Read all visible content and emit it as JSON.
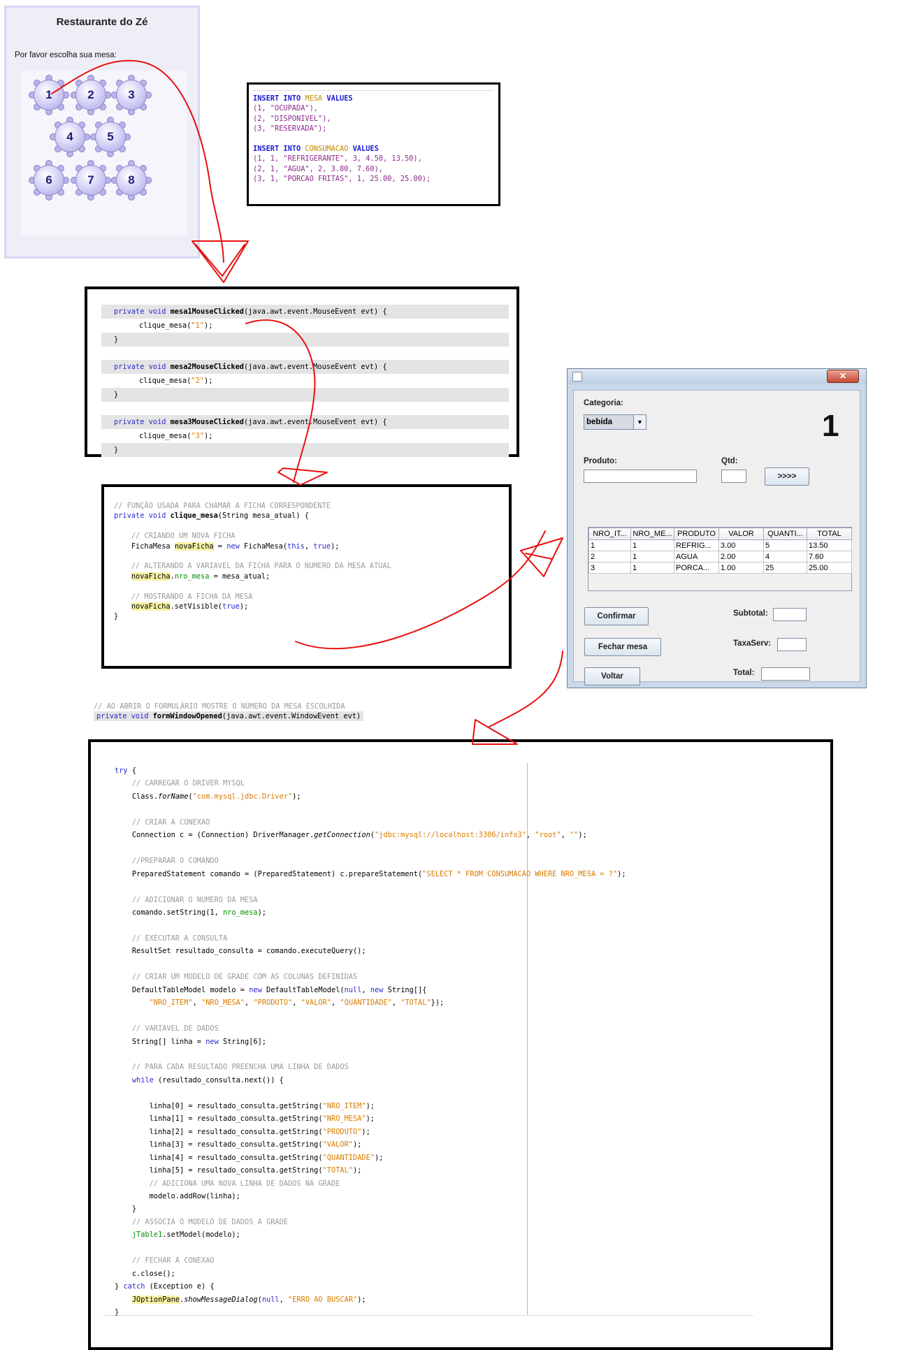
{
  "restaurant": {
    "title": "Restaurante do Zé",
    "prompt": "Por favor escolha sua mesa:",
    "tables": [
      "1",
      "2",
      "3",
      "4",
      "5",
      "6",
      "7",
      "8"
    ]
  },
  "sql": {
    "lines": [
      [
        [
          "kw",
          "INSERT INTO "
        ],
        [
          "tbl",
          "MESA"
        ],
        [
          "kw",
          " VALUES"
        ]
      ],
      [
        [
          "num",
          "(1, \"OCUPADA\"),"
        ]
      ],
      [
        [
          "num",
          "(2, \"DISPONIVEL\"),"
        ]
      ],
      [
        [
          "num",
          "(3, \"RESERVADA\");"
        ]
      ],
      [],
      [
        [
          "kw",
          "INSERT INTO "
        ],
        [
          "tbl",
          "CONSUMACAO"
        ],
        [
          "kw",
          " VALUES"
        ]
      ],
      [
        [
          "num",
          "(1, 1, \"REFRIGERANTE\", 3, 4.50, 13.50),"
        ]
      ],
      [
        [
          "num",
          "(2, 1, \"AGUA\", 2, 3.80, 7.60),"
        ]
      ],
      [
        [
          "num",
          "(3, 1, \"PORCAO FRITAS\", 1, 25.00, 25.00);"
        ]
      ]
    ]
  },
  "handlers": {
    "blocks": [
      {
        "sig_kw": "private void ",
        "sig_name": "mesa1MouseClicked",
        "sig_rest": "(java.awt.event.MouseEvent evt) {",
        "call": "clique_mesa(",
        "arg": "\"1\"",
        "end": ");",
        "close": "}"
      },
      {
        "sig_kw": "private void ",
        "sig_name": "mesa2MouseClicked",
        "sig_rest": "(java.awt.event.MouseEvent evt) {",
        "call": "clique_mesa(",
        "arg": "\"2\"",
        "end": ");",
        "close": "}"
      },
      {
        "sig_kw": "private void ",
        "sig_name": "mesa3MouseClicked",
        "sig_rest": "(java.awt.event.MouseEvent evt) {",
        "call": "clique_mesa(",
        "arg": "\"3\"",
        "end": ");",
        "close": "}"
      }
    ]
  },
  "clique": {
    "comment": "// FUNÇÃO USADA PARA CHAMAR A FICHA CORRESPONDENTE",
    "sig_kw": "private void ",
    "sig_name": "clique_mesa",
    "sig_rest": "(String mesa_atual) {",
    "c1": "// CRIANDO UM NOVA FICHA",
    "l1a": "FichaMesa ",
    "l1b": "novaFicha",
    "l1c": " = ",
    "l1d": "new",
    "l1e": " FichaMesa(",
    "l1f": "this",
    "l1g": ", ",
    "l1h": "true",
    "l1i": ");",
    "c2": "// ALTERANDO A VARIAVEL DA FICHA PARA O NUMERO DA MESA ATUAL",
    "l2a": "novaFicha",
    "l2b": ".",
    "l2c": "nro_mesa",
    "l2d": " = mesa_atual;",
    "c3": "// MOSTRANDO A FICHA DA MESA",
    "l3a": "novaFicha",
    "l3b": ".setVisible(",
    "l3c": "true",
    "l3d": ");",
    "close": "}"
  },
  "form": {
    "categoria_label": "Categoria:",
    "categoria_value": "bebida",
    "mesa_number": "1",
    "produto_label": "Produto:",
    "qtd_label": "Qtd:",
    "add_button": ">>>>",
    "columns": [
      "NRO_IT...",
      "NRO_ME...",
      "PRODUTO",
      "VALOR",
      "QUANTI...",
      "TOTAL"
    ],
    "rows": [
      [
        "1",
        "1",
        "REFRIG...",
        "3.00",
        "5",
        "13.50"
      ],
      [
        "2",
        "1",
        "AGUA",
        "2.00",
        "4",
        "7.60"
      ],
      [
        "3",
        "1",
        "PORCA...",
        "1.00",
        "25",
        "25.00"
      ]
    ],
    "confirmar": "Confirmar",
    "fechar": "Fechar mesa",
    "voltar": "Voltar",
    "subtotal_label": "Subtotal:",
    "taxa_label": "TaxaServ:",
    "total_label": "Total:"
  },
  "opened": {
    "comment": "// AO ABRIR O FORMULÁRIO MOSTRE O NÚMERO DA MESA ESCOLHIDA",
    "sig_kw": "private void ",
    "sig_name": "formWindowOpened",
    "sig_rest": "(java.awt.event.WindowEvent evt)"
  },
  "body_code": [
    [
      [
        "kw",
        "try"
      ],
      [
        "t",
        " {"
      ]
    ],
    [
      [
        "i",
        "    "
      ],
      [
        "cm",
        "// CARREGAR O DRIVER MYSQL"
      ]
    ],
    [
      [
        "i",
        "    "
      ],
      [
        "t",
        "Class."
      ],
      [
        "it",
        "forName"
      ],
      [
        "t",
        "("
      ],
      [
        "s",
        "\"com.mysql.jdbc.Driver\""
      ],
      [
        "t",
        ");"
      ]
    ],
    [],
    [
      [
        "i",
        "    "
      ],
      [
        "cm",
        "// CRIAR A CONEXAO"
      ]
    ],
    [
      [
        "i",
        "    "
      ],
      [
        "t",
        "Connection c = (Connection) DriverManager."
      ],
      [
        "it",
        "getConnection"
      ],
      [
        "t",
        "("
      ],
      [
        "s",
        "\"jdbc:mysql://localhost:3306/info3\""
      ],
      [
        "t",
        ", "
      ],
      [
        "s",
        "\"root\""
      ],
      [
        "t",
        ", "
      ],
      [
        "s",
        "\"\""
      ],
      [
        "t",
        ");"
      ]
    ],
    [],
    [
      [
        "i",
        "    "
      ],
      [
        "cm",
        "//PREPARAR O COMANDO"
      ]
    ],
    [
      [
        "i",
        "    "
      ],
      [
        "t",
        "PreparedStatement comando = (PreparedStatement) c.prepareStatement("
      ],
      [
        "s",
        "\"SELECT * FROM CONSUMACAO WHERE NRO_MESA = ?\""
      ],
      [
        "t",
        ");"
      ]
    ],
    [],
    [
      [
        "i",
        "    "
      ],
      [
        "cm",
        "// ADICIONAR O NUMERO DA MESA"
      ]
    ],
    [
      [
        "i",
        "    "
      ],
      [
        "t",
        "comando.setString(1, "
      ],
      [
        "f",
        "nro_mesa"
      ],
      [
        "t",
        ");"
      ]
    ],
    [],
    [
      [
        "i",
        "    "
      ],
      [
        "cm",
        "// EXECUTAR A CONSULTA"
      ]
    ],
    [
      [
        "i",
        "    "
      ],
      [
        "t",
        "ResultSet resultado_consulta = comando.executeQuery();"
      ]
    ],
    [],
    [
      [
        "i",
        "    "
      ],
      [
        "cm",
        "// CRIAR UM MODELO DE GRADE COM AS COLUNAS DEFINIDAS"
      ]
    ],
    [
      [
        "i",
        "    "
      ],
      [
        "t",
        "DefaultTableModel modelo = "
      ],
      [
        "kw",
        "new"
      ],
      [
        "t",
        " DefaultTableModel("
      ],
      [
        "kw",
        "null"
      ],
      [
        "t",
        ", "
      ],
      [
        "kw",
        "new"
      ],
      [
        "t",
        " String[]{"
      ]
    ],
    [
      [
        "i",
        "        "
      ],
      [
        "s",
        "\"NRO_ITEM\""
      ],
      [
        "t",
        ", "
      ],
      [
        "s",
        "\"NRO_MESA\""
      ],
      [
        "t",
        ", "
      ],
      [
        "s",
        "\"PRODUTO\""
      ],
      [
        "t",
        ", "
      ],
      [
        "s",
        "\"VALOR\""
      ],
      [
        "t",
        ", "
      ],
      [
        "s",
        "\"QUANTIDADE\""
      ],
      [
        "t",
        ", "
      ],
      [
        "s",
        "\"TOTAL\""
      ],
      [
        "t",
        "});"
      ]
    ],
    [],
    [
      [
        "i",
        "    "
      ],
      [
        "cm",
        "// VARIAVEL DE DADOS"
      ]
    ],
    [
      [
        "i",
        "    "
      ],
      [
        "t",
        "String[] linha = "
      ],
      [
        "kw",
        "new"
      ],
      [
        "t",
        " String[6];"
      ]
    ],
    [],
    [
      [
        "i",
        "    "
      ],
      [
        "cm",
        "// PARA CADA RESULTADO PREENCHA UMA LINHA DE DADOS"
      ]
    ],
    [
      [
        "i",
        "    "
      ],
      [
        "kw",
        "while"
      ],
      [
        "t",
        " (resultado_consulta.next()) {"
      ]
    ],
    [],
    [
      [
        "i",
        "        "
      ],
      [
        "t",
        "linha[0] = resultado_consulta.getString("
      ],
      [
        "s",
        "\"NRO_ITEM\""
      ],
      [
        "t",
        ");"
      ]
    ],
    [
      [
        "i",
        "        "
      ],
      [
        "t",
        "linha[1] = resultado_consulta.getString("
      ],
      [
        "s",
        "\"NRO_MESA\""
      ],
      [
        "t",
        ");"
      ]
    ],
    [
      [
        "i",
        "        "
      ],
      [
        "t",
        "linha[2] = resultado_consulta.getString("
      ],
      [
        "s",
        "\"PRODUTO\""
      ],
      [
        "t",
        ");"
      ]
    ],
    [
      [
        "i",
        "        "
      ],
      [
        "t",
        "linha[3] = resultado_consulta.getString("
      ],
      [
        "s",
        "\"VALOR\""
      ],
      [
        "t",
        ");"
      ]
    ],
    [
      [
        "i",
        "        "
      ],
      [
        "t",
        "linha[4] = resultado_consulta.getString("
      ],
      [
        "s",
        "\"QUANTIDADE\""
      ],
      [
        "t",
        ");"
      ]
    ],
    [
      [
        "i",
        "        "
      ],
      [
        "t",
        "linha[5] = resultado_consulta.getString("
      ],
      [
        "s",
        "\"TOTAL\""
      ],
      [
        "t",
        ");"
      ]
    ],
    [
      [
        "i",
        "        "
      ],
      [
        "cm",
        "// ADICIONA UMA NOVA LINHA DE DADOS NA GRADE"
      ]
    ],
    [
      [
        "i",
        "        "
      ],
      [
        "t",
        "modelo.addRow(linha);"
      ]
    ],
    [
      [
        "i",
        "    "
      ],
      [
        "t",
        "}"
      ]
    ],
    [
      [
        "i",
        "    "
      ],
      [
        "cm",
        "// ASSOCIA O MODELO DE DADOS A GRADE"
      ]
    ],
    [
      [
        "i",
        "    "
      ],
      [
        "f",
        "jTable1"
      ],
      [
        "t",
        ".setModel(modelo);"
      ]
    ],
    [],
    [
      [
        "i",
        "    "
      ],
      [
        "cm",
        "// FECHAR A CONEXAO"
      ]
    ],
    [
      [
        "i",
        "    "
      ],
      [
        "t",
        "c.close();"
      ]
    ],
    [
      [
        "t",
        "} "
      ],
      [
        "kw",
        "catch"
      ],
      [
        "t",
        " (Exception e) {"
      ]
    ],
    [
      [
        "i",
        "    "
      ],
      [
        "hl",
        "JOptionPane"
      ],
      [
        "t",
        "."
      ],
      [
        "it",
        "showMessageDialog"
      ],
      [
        "t",
        "("
      ],
      [
        "kw",
        "null"
      ],
      [
        "t",
        ", "
      ],
      [
        "s",
        "\"ERRO AO BUSCAR\""
      ],
      [
        "t",
        ");"
      ]
    ],
    [
      [
        "t",
        "}"
      ]
    ]
  ],
  "colors": {
    "arrow": "#e81010",
    "keyword": "#2b2bd0",
    "string": "#d97b00",
    "comment": "#9a9a9a"
  }
}
